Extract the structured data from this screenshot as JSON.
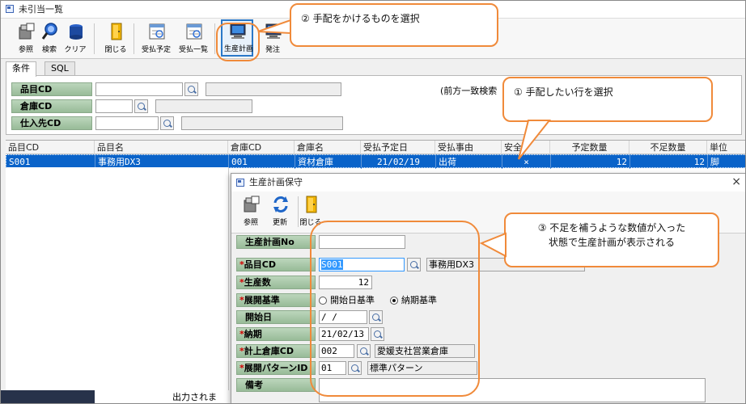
{
  "window": {
    "title": "未引当一覧"
  },
  "toolbar": [
    {
      "id": "ref",
      "label": "参照",
      "icon": "reference-icon"
    },
    {
      "id": "search",
      "label": "検索",
      "icon": "search-icon"
    },
    {
      "id": "clear",
      "label": "クリア",
      "icon": "clear-icon"
    },
    {
      "id": "close",
      "label": "閉じる",
      "icon": "door-icon"
    },
    {
      "id": "plan",
      "label": "受払予定",
      "icon": "schedule-icon"
    },
    {
      "id": "list",
      "label": "受払一覧",
      "icon": "list-icon"
    },
    {
      "id": "prod",
      "label": "生産計画",
      "icon": "production-plan-icon"
    },
    {
      "id": "order",
      "label": "発注",
      "icon": "order-icon"
    }
  ],
  "tabs": [
    "条件",
    "SQL"
  ],
  "conditions": {
    "item_cd_label": "品目CD",
    "warehouse_cd_label": "倉庫CD",
    "supplier_cd_label": "仕入先CD",
    "prefix_note": "(前方一致検索"
  },
  "grid": {
    "headers": [
      "品目CD",
      "品目名",
      "倉庫CD",
      "倉庫名",
      "受払予定日",
      "受払事由",
      "安全",
      "予定数量",
      "不足数量",
      "単位"
    ],
    "rows": [
      {
        "item_cd": "S001",
        "item_name": "事務用DX3",
        "wh_cd": "001",
        "wh_name": "資材倉庫",
        "date": "21/02/19",
        "reason": "出荷",
        "safety": "×",
        "planned": "12",
        "shortage": "12",
        "unit": "脚"
      }
    ]
  },
  "footer_text": "出力されま",
  "dialog": {
    "title": "生産計画保守",
    "close_glyph": "×",
    "toolbar": [
      {
        "label": "参照",
        "icon": "reference-icon"
      },
      {
        "label": "更新",
        "icon": "refresh-icon"
      },
      {
        "label": "閉じる",
        "icon": "door-icon"
      }
    ],
    "plan_no_label": "生産計画No",
    "plan_no_value": "",
    "item_cd_label": "品目CD",
    "item_cd_value": "S001",
    "item_name_value": "事務用DX3",
    "qty_label": "生産数",
    "qty_value": "12",
    "basis_label": "展開基準",
    "basis_options": [
      "開始日基準",
      "納期基準"
    ],
    "basis_selected": "納期基準",
    "start_label": "開始日",
    "start_value": " / /",
    "due_label": "納期",
    "due_value": "21/02/13",
    "wh_label": "計上倉庫CD",
    "wh_cd_value": "002",
    "wh_name_value": "愛媛支社営業倉庫",
    "pattern_label": "展開パターンID",
    "pattern_id_value": "01",
    "pattern_name_value": "標準パターン",
    "memo_label": "備考",
    "required_mark": "*"
  },
  "callouts": {
    "step1": "① 手配したい行を選択",
    "step2": "② 手配をかけるものを選択",
    "step3_line1": "③ 不足を補うような数値が入った",
    "step3_line2": "状態で生産計画が表示される"
  },
  "colors": {
    "accent": "#f08a3a",
    "selection": "#0a63c9",
    "label_green": "#a8c8a8"
  }
}
